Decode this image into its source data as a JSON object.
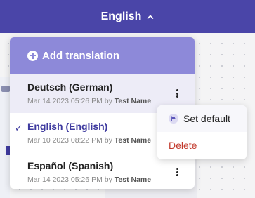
{
  "header": {
    "current_language": "English"
  },
  "dropdown": {
    "add_label": "Add translation",
    "items": [
      {
        "name": "Deutsch (German)",
        "date": "Mar 14 2023 05:26 PM",
        "by": "by",
        "author": "Test Name"
      },
      {
        "name": "English (English)",
        "date": "Mar 10 2023 08:22 PM",
        "by": "by",
        "author": "Test Name",
        "check": "✓"
      },
      {
        "name": "Español (Spanish)",
        "date": "Mar 14 2023 05:26 PM",
        "by": "by",
        "author": "Test Name"
      }
    ]
  },
  "context_menu": {
    "set_default_label": "Set default",
    "delete_label": "Delete"
  },
  "colors": {
    "header_bg": "#4a45a8",
    "add_button_bg": "#8d89d9",
    "selected_text": "#3e3a9f",
    "delete_text": "#c2382b"
  },
  "icons": {
    "header_chevron": "chevron-up-icon",
    "add": "plus-circle-icon",
    "selected": "check-icon",
    "row_menu": "kebab-icon",
    "set_default": "flag-icon"
  }
}
